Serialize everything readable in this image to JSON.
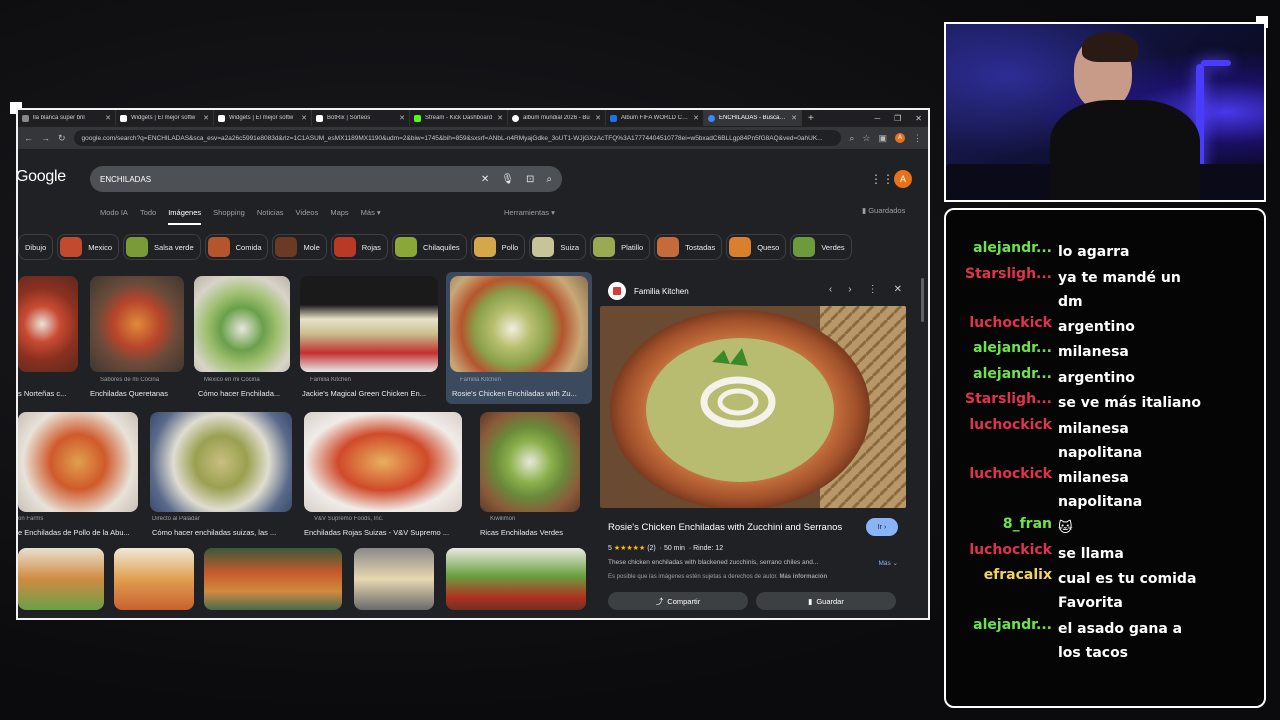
{
  "browser": {
    "tabs": [
      {
        "label": "lla blanca super bril",
        "color": "#888"
      },
      {
        "label": "Widgets | El mejor softw",
        "color": "#fff"
      },
      {
        "label": "Widgets | El mejor softw",
        "color": "#fff"
      },
      {
        "label": "BotRix | Sorteos",
        "color": "#fff"
      },
      {
        "label": "Stream - Kick Dashboard",
        "color": "#53fc18"
      },
      {
        "label": "album mundial 2026 - Bu",
        "color": "#fff"
      },
      {
        "label": "Album FIFA WORLD CUP",
        "color": "#1a73e8"
      },
      {
        "label": "ENCHILADAS - Buscar co",
        "color": "#4285f4"
      }
    ],
    "url": "google.com/search?q=ENCHILADAS&sca_esv=a2a26c5991e8083d&rlz=1C1ASUM_esMX1189MX1190&udm=2&biw=1745&bih=859&sxsrf=ANbL-n4RMyajGdke_3oUT1-WJjGXzAcTFQ%3A17774404510778ei=w5bxadC6BLLgp84Pn5fG8AQ&ved=0ahUK...",
    "profile_initial": "A"
  },
  "google": {
    "logo": "Google",
    "query": "ENCHILADAS",
    "tabs": [
      "Modo IA",
      "Todo",
      "Imágenes",
      "Shopping",
      "Noticias",
      "Videos",
      "Maps",
      "Más ▾"
    ],
    "active_tab": "Imágenes",
    "tools": "Herramientas ▾",
    "saved": "Guardados",
    "chips": [
      {
        "label": "Dibujo",
        "color": "#c9a27a"
      },
      {
        "label": "Mexico",
        "color": "#c24a2e"
      },
      {
        "label": "Salsa verde",
        "color": "#7a9a3a"
      },
      {
        "label": "Comida",
        "color": "#b5552e"
      },
      {
        "label": "Mole",
        "color": "#6b3a24"
      },
      {
        "label": "Rojas",
        "color": "#b83a26"
      },
      {
        "label": "Chilaquiles",
        "color": "#8aa83a"
      },
      {
        "label": "Pollo",
        "color": "#d4a84a"
      },
      {
        "label": "Suiza",
        "color": "#c7c49a"
      },
      {
        "label": "Platillo",
        "color": "#9aaa52"
      },
      {
        "label": "Tostadas",
        "color": "#c56a3a"
      },
      {
        "label": "Queso",
        "color": "#d9802e"
      },
      {
        "label": "Verdes",
        "color": "#6d9a3c"
      }
    ],
    "results_row1": [
      {
        "source": "",
        "title": "s Norteñas c..."
      },
      {
        "source": "Sabores de mi Cocina",
        "title": "Enchiladas Queretanas"
      },
      {
        "source": "México en mi Cocina",
        "title": "Cómo hacer Enchilada..."
      },
      {
        "source": "Familia Kitchen",
        "title": "Jackie's Magical Green Chicken En..."
      },
      {
        "source": "Familia Kitchen",
        "title": "Rosie's Chicken Enchiladas with Zu..."
      }
    ],
    "results_row2": [
      {
        "source": "on Farms",
        "title": "e Enchiladas de Pollo de la Abu..."
      },
      {
        "source": "Directo al Paladar",
        "title": "Cómo hacer enchiladas suizas, las ..."
      },
      {
        "source": "V&V Supremo Foods, Inc.",
        "title": "Enchiladas Rojas Suizas - V&V Supremo ..."
      },
      {
        "source": "Kiwilimon",
        "title": "Ricas Enchiladas Verdes"
      }
    ],
    "panel": {
      "source": "Familia Kitchen",
      "title": "Rosie's Chicken Enchiladas with Zucchini and Serranos",
      "go_button": "Ir",
      "rating": "5",
      "stars": "★★★★★",
      "reviews": "(2)",
      "time": "50 min",
      "yield": "Rinde: 12",
      "description": "These chicken enchiladas with blackened zucchinis, serrano chiles and...",
      "more": "Más",
      "copyright": "Es posible que las imágenes estén sujetas a derechos de autor.",
      "more_info": "Más información",
      "share": "Compartir",
      "save": "Guardar"
    }
  },
  "chat": {
    "messages": [
      {
        "user": "alejandr...",
        "color": "#6fe34c",
        "text": "lo agarra"
      },
      {
        "user": "Starsligh...",
        "color": "#e0334d",
        "text": "ya te mandé un dm"
      },
      {
        "user": "luchockick",
        "color": "#e0334d",
        "text": "argentino"
      },
      {
        "user": "alejandr...",
        "color": "#6fe34c",
        "text": "milanesa"
      },
      {
        "user": "alejandr...",
        "color": "#6fe34c",
        "text": "argentino"
      },
      {
        "user": "Starsligh...",
        "color": "#e0334d",
        "text": "se ve más italiano"
      },
      {
        "user": "luchockick",
        "color": "#e0334d",
        "text": "milanesa napolitana"
      },
      {
        "user": "luchockick",
        "color": "#e0334d",
        "text": "milanesa napolitana"
      },
      {
        "user": "8_fran",
        "color": "#6fe34c",
        "text": "🐱"
      },
      {
        "user": "luchockick",
        "color": "#e0334d",
        "text": "se llama"
      },
      {
        "user": "efracalix",
        "color": "#f2d35c",
        "text": "cual es tu comida Favorita"
      },
      {
        "user": "alejandr...",
        "color": "#6fe34c",
        "text": "el asado gana a los tacos"
      }
    ]
  }
}
